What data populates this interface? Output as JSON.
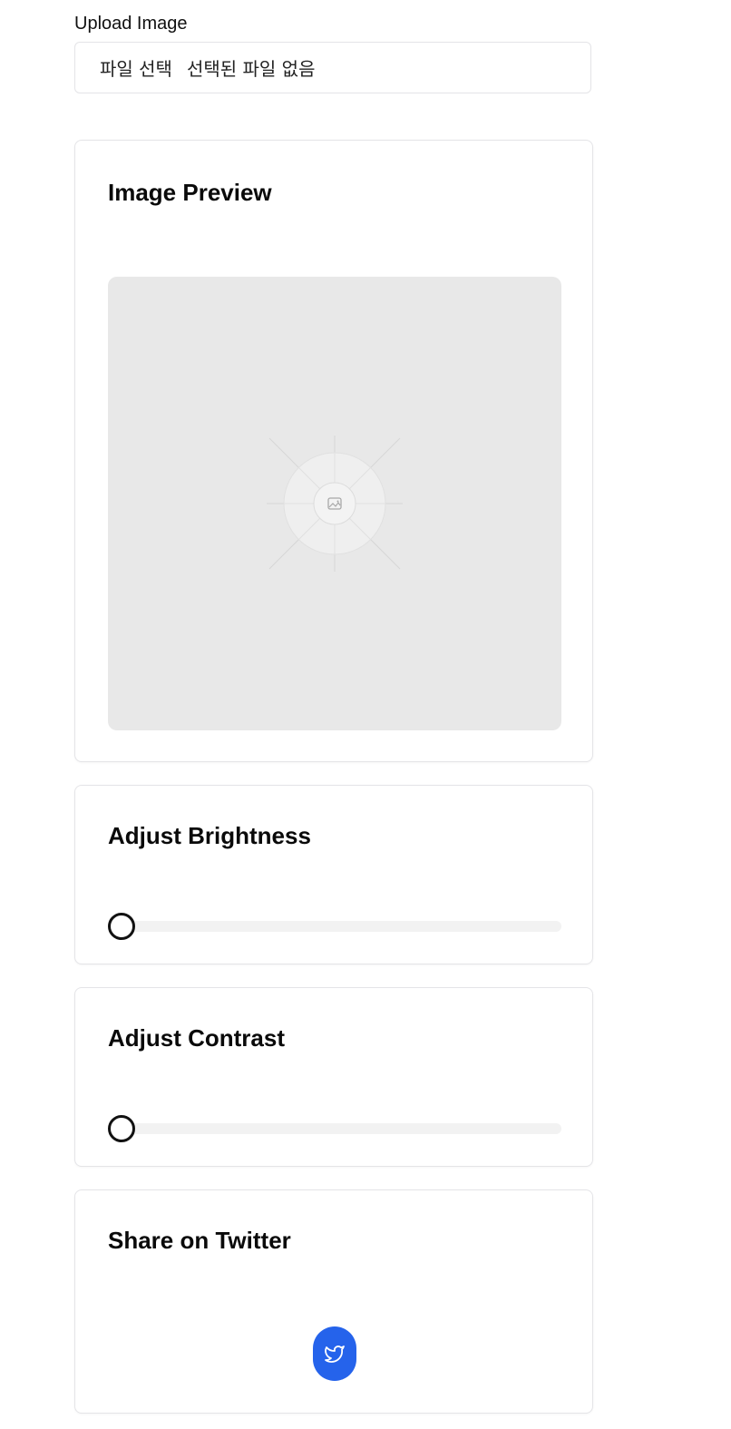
{
  "upload": {
    "label": "Upload Image",
    "button_label": "파일 선택",
    "status_text": "선택된 파일 없음"
  },
  "preview": {
    "title": "Image Preview",
    "icon": "image-placeholder-icon"
  },
  "brightness": {
    "title": "Adjust Brightness",
    "value_fraction": 0
  },
  "contrast": {
    "title": "Adjust Contrast",
    "value_fraction": 0
  },
  "share": {
    "title": "Share on Twitter",
    "icon": "twitter-icon",
    "button_color": "#2563eb"
  }
}
